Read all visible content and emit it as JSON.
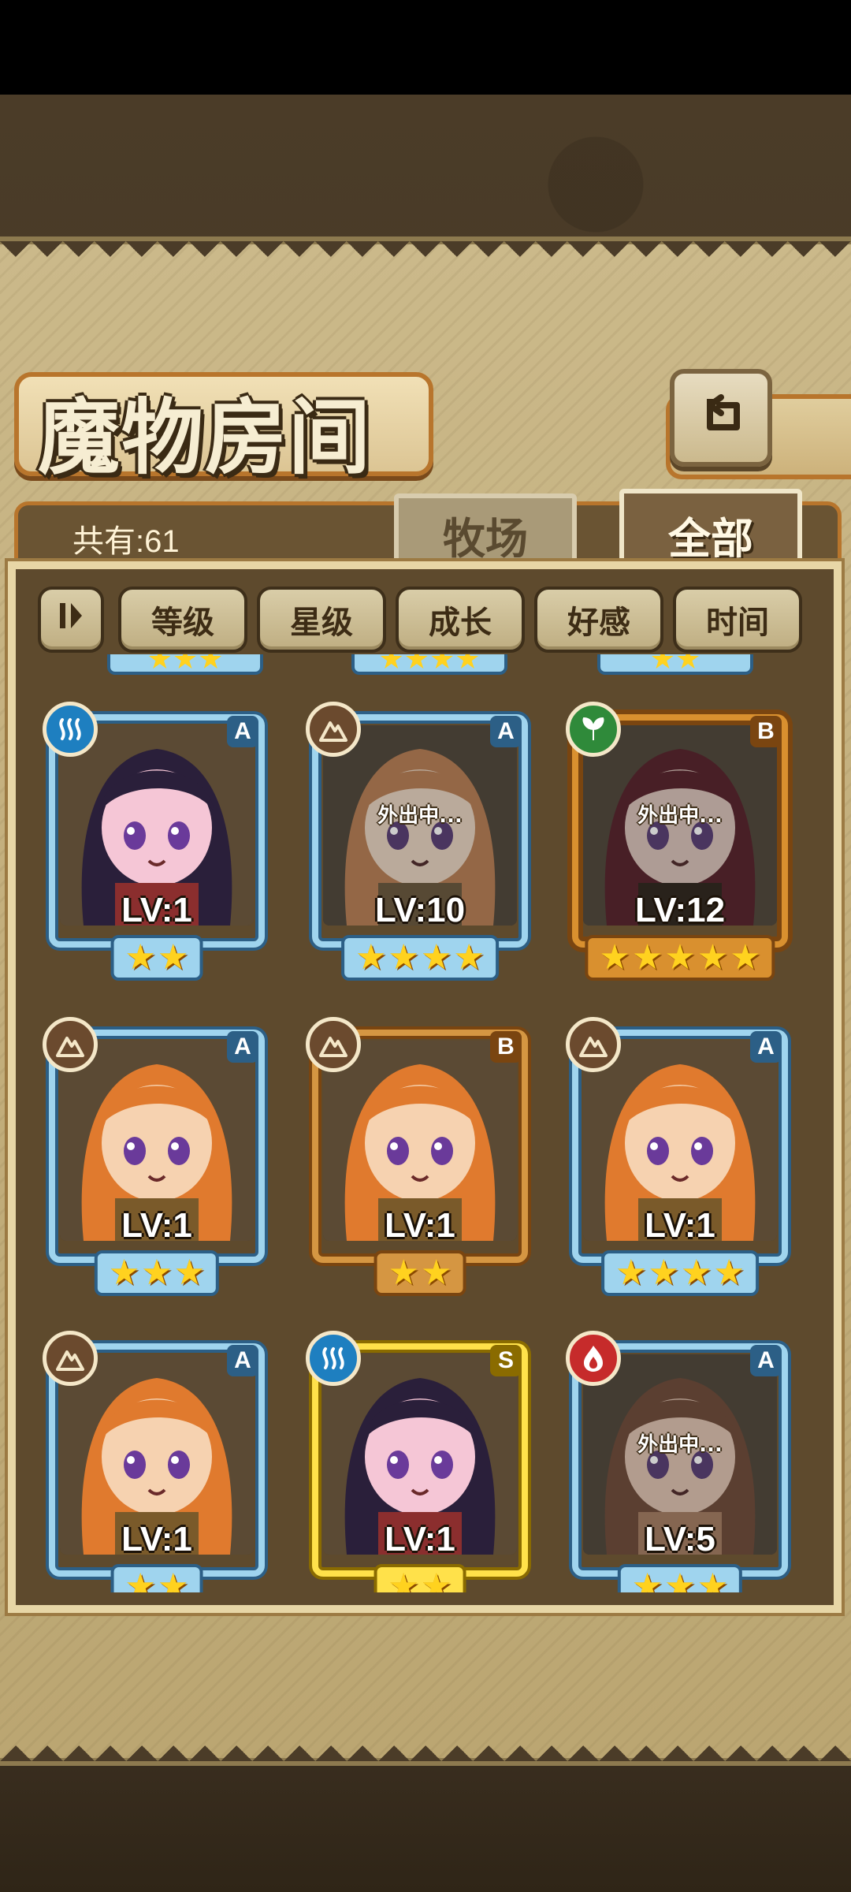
{
  "header": {
    "title": "魔物房间",
    "back_icon": "return-arrow-icon"
  },
  "info": {
    "count_text": "共有:61"
  },
  "tabs": [
    {
      "label": "牧场",
      "active": false
    },
    {
      "label": "全部",
      "active": true
    }
  ],
  "sort_buttons": {
    "toggle_icon": "sort-order-icon",
    "items": [
      "等级",
      "星级",
      "成长",
      "好感",
      "时间"
    ]
  },
  "away_text": "外出中...",
  "cards": [
    {
      "level": "LV:1",
      "stars": 2,
      "rank": "A",
      "element": "water",
      "frame": "rare-A",
      "away": false
    },
    {
      "level": "LV:10",
      "stars": 4,
      "rank": "A",
      "element": "earth",
      "frame": "rare-A",
      "away": true
    },
    {
      "level": "LV:12",
      "stars": 5,
      "rank": "B",
      "element": "wood",
      "frame": "ornate",
      "away": true
    },
    {
      "level": "LV:1",
      "stars": 3,
      "rank": "A",
      "element": "earth",
      "frame": "rare-A",
      "away": false
    },
    {
      "level": "LV:1",
      "stars": 2,
      "rank": "B",
      "element": "earth",
      "frame": "rare-B",
      "away": false
    },
    {
      "level": "LV:1",
      "stars": 4,
      "rank": "A",
      "element": "earth",
      "frame": "rare-A",
      "away": false
    },
    {
      "level": "LV:1",
      "stars": 2,
      "rank": "A",
      "element": "earth",
      "frame": "rare-A",
      "away": false
    },
    {
      "level": "LV:1",
      "stars": 2,
      "rank": "S",
      "element": "water",
      "frame": "rare-S",
      "away": false
    },
    {
      "level": "LV:5",
      "stars": 3,
      "rank": "A",
      "element": "fire",
      "frame": "rare-A",
      "away": true
    }
  ],
  "colors": {
    "water": "#1e7fc0",
    "earth": "#6b4a2e",
    "wood": "#2f8a3a",
    "fire": "#c62b2b",
    "star": "#ffd21f"
  }
}
